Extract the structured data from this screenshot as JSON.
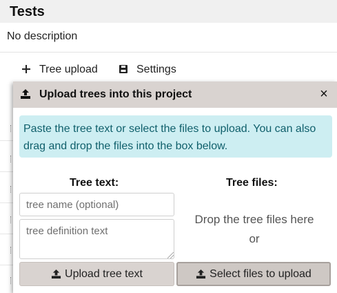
{
  "project": {
    "title": "Tests",
    "description": "No description"
  },
  "toolbar": {
    "tree_upload_label": "Tree upload",
    "settings_label": "Settings"
  },
  "modal": {
    "title": "Upload trees into this project",
    "close_glyph": "×",
    "info_text": "Paste the tree text or select the files to upload. You can also drag and drop the files into the box below.",
    "tree_text_heading": "Tree text:",
    "tree_files_heading": "Tree files:",
    "tree_name_placeholder": "tree name (optional)",
    "tree_definition_placeholder": "tree definition text",
    "drop_text": "Drop the tree files here",
    "drop_or": "or",
    "upload_text_button": "Upload tree text",
    "select_files_button": "Select files to upload"
  },
  "colors": {
    "modal_header": "#d9d3d0",
    "info_background": "#cdeef2",
    "info_text": "#0f5f6b",
    "button_background": "#d9d3d0"
  },
  "icons": {
    "tree_upload": "plus-icon",
    "settings": "save-icon",
    "modal_title": "upload-icon",
    "upload_button": "upload-icon",
    "select_button": "upload-icon"
  }
}
